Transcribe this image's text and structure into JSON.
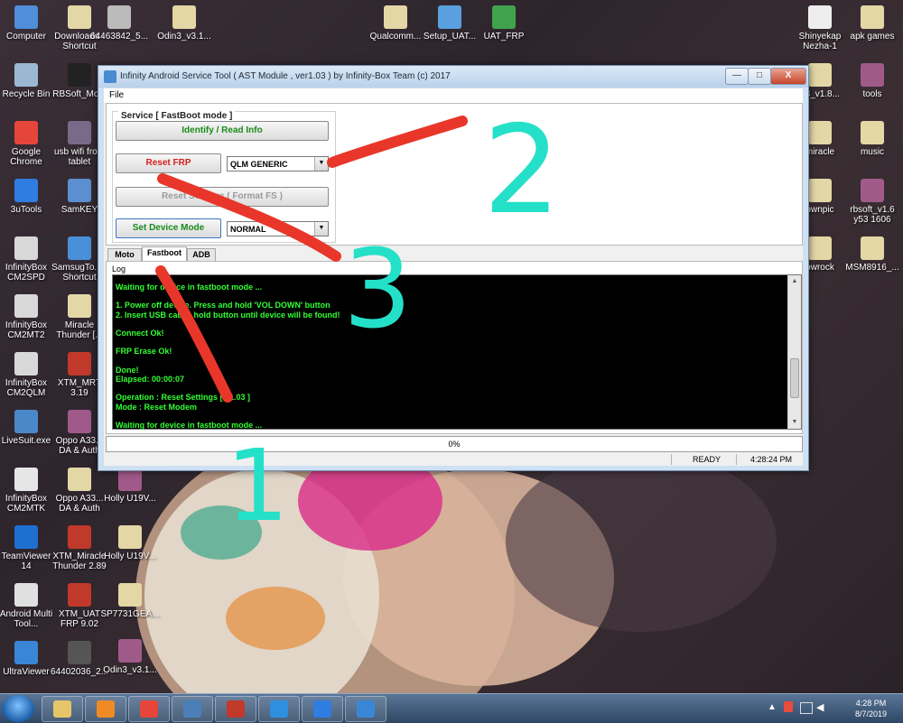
{
  "desktop": {
    "icons_left": [
      {
        "label": "Computer",
        "color": "#4f8ed8"
      },
      {
        "label": "Recycle Bin",
        "color": "#9bb8d3"
      },
      {
        "label": "Google Chrome",
        "color": "#e6453a"
      },
      {
        "label": "3uTools",
        "color": "#2f7de1"
      },
      {
        "label": "InfinityBox CM2SPD",
        "color": "#d8d8d8"
      },
      {
        "label": "InfinityBox CM2MT2",
        "color": "#d8d8d8"
      },
      {
        "label": "InfinityBox CM2QLM",
        "color": "#d8d8d8"
      },
      {
        "label": "LiveSuit.exe",
        "color": "#4b88c9"
      },
      {
        "label": "InfinityBox CM2MTK",
        "color": "#e6e6e6"
      },
      {
        "label": "TeamViewer 14",
        "color": "#1f6fd1"
      },
      {
        "label": "Android Multi Tool...",
        "color": "#e0e0e0"
      },
      {
        "label": "UltraViewer",
        "color": "#3a86d6"
      }
    ],
    "icons_col2": [
      {
        "label": "Downloads - Shortcut",
        "color": "#e4d7a6"
      },
      {
        "label": "RBSoft_Mo...",
        "color": "#222222"
      },
      {
        "label": "usb wifi from tablet",
        "color": "#7a6a8a"
      },
      {
        "label": "SamKEY",
        "color": "#5b8fd0"
      },
      {
        "label": "SamsugTo... - Shortcut",
        "color": "#4a90d8"
      },
      {
        "label": "Miracle Thunder [...",
        "color": "#e4d7a6"
      },
      {
        "label": "XTM_MRT 3.19",
        "color": "#c0392b"
      },
      {
        "label": "Oppo A33... DA & Auth",
        "color": "#a05a8a"
      },
      {
        "label": "Oppo A33... DA & Auth",
        "color": "#e4d7a6"
      },
      {
        "label": "XTM_Miracle Thunder 2.89",
        "color": "#c0392b"
      },
      {
        "label": "XTM_UAT FRP 9.02",
        "color": "#c0392b"
      },
      {
        "label": "64402036_2...",
        "color": "#555555"
      }
    ],
    "icons_col3": [
      {
        "label": "Holly U19V...",
        "color": "#a05a8a"
      },
      {
        "label": "Holly U19V...",
        "color": "#e4d7a6"
      },
      {
        "label": "SP7731GEA...",
        "color": "#e4d7a6"
      },
      {
        "label": "Odin3_v3.1...",
        "color": "#a05a8a"
      }
    ],
    "icons_top": [
      {
        "label": "64463842_5...",
        "color": "#bbbbbb"
      },
      {
        "label": "Odin3_v3.1...",
        "color": "#e4d7a6"
      },
      {
        "label": "Qualcomm...",
        "color": "#e4d7a6"
      },
      {
        "label": "Setup_UAT...",
        "color": "#5aa0e0"
      },
      {
        "label": "UAT_FRP",
        "color": "#3fa34d"
      }
    ],
    "icons_right1": [
      {
        "label": "Shinyekap Nezha-1",
        "color": "#eeeeee"
      },
      {
        "label": "n3_v1.8...",
        "color": "#e4d7a6"
      },
      {
        "label": "miracle",
        "color": "#e4d7a6"
      },
      {
        "label": "ownpic",
        "color": "#e4d7a6"
      },
      {
        "label": "owrock",
        "color": "#e4d7a6"
      }
    ],
    "icons_right2": [
      {
        "label": "apk games",
        "color": "#e4d7a6"
      },
      {
        "label": "tools",
        "color": "#a05a8a"
      },
      {
        "label": "music",
        "color": "#e4d7a6"
      },
      {
        "label": "rbsoft_v1.6 y53 1606",
        "color": "#a05a8a"
      },
      {
        "label": "MSM8916_...",
        "color": "#e4d7a6"
      }
    ]
  },
  "window": {
    "title": "Infinity Android Service Tool ( AST Module , ver1.03 ) by Infinity-Box Team (c) 2017",
    "minimize_label": "—",
    "maximize_label": "□",
    "close_label": "X",
    "menu": {
      "file": "File"
    },
    "service_group": "Service [ FastBoot mode ]",
    "buttons": {
      "identify": "Identify / Read Info",
      "reset_frp": "Reset FRP",
      "reset_settings": "Reset Settings ( Format FS )",
      "set_device_mode": "Set Device Mode"
    },
    "combos": {
      "frp_method": "QLM GENERIC",
      "device_mode": "NORMAL"
    },
    "tabs": [
      "Moto",
      "Fastboot",
      "ADB"
    ],
    "active_tab": "Fastboot",
    "log_label": "Log",
    "log_lines": [
      "Waiting for device in fastboot mode ...",
      "",
      "1. Power off device. Press and hold 'VOL DOWN' button",
      "2. Insert USB cable, hold button until device will be found!",
      "",
      "Connect Ok!",
      "",
      "FRP Erase Ok!",
      "",
      "Done!",
      "Elapsed: 00:00:07",
      "",
      "Operation : Reset Settings [ v1.03 ]",
      "Mode : Reset Modem",
      "",
      "Waiting for device in fastboot mode ..."
    ],
    "progress": {
      "value": 0,
      "text": "0%"
    },
    "status": {
      "state": "READY",
      "time": "4:28:24 PM"
    }
  },
  "annotations": {
    "labels": [
      "1",
      "2",
      "3"
    ],
    "red": "#e8372a",
    "cyan": "#25e0c8"
  },
  "taskbar": {
    "apps": [
      {
        "name": "explorer",
        "color": "#e7c56a"
      },
      {
        "name": "media-player",
        "color": "#f08a24"
      },
      {
        "name": "chrome",
        "color": "#e6453a"
      },
      {
        "name": "control-panel",
        "color": "#4a7fb8"
      },
      {
        "name": "toolbox",
        "color": "#c0392b"
      },
      {
        "name": "ie",
        "color": "#2f8fdf"
      },
      {
        "name": "3utools",
        "color": "#2f7de1"
      },
      {
        "name": "ast",
        "color": "#3a86d6"
      }
    ],
    "clock_time": "4:28 PM",
    "clock_date": "8/7/2019"
  }
}
